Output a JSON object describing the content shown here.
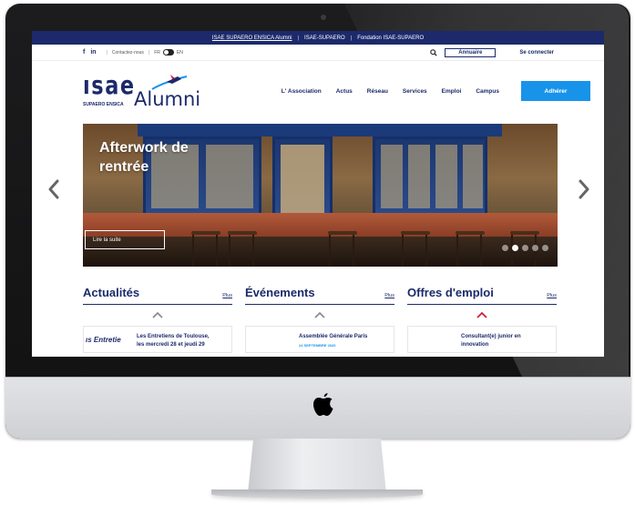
{
  "topbar": {
    "links": [
      "ISAE SUPAERO ENSICA Alumni",
      "ISAE-SUPAERO",
      "Fondation ISAE-SUPAERO"
    ]
  },
  "secondbar": {
    "social": [
      "f",
      "in"
    ],
    "contact": "Contactez-nous",
    "lang_fr": "FR",
    "lang_en": "EN",
    "annuaire": "Annuaire",
    "connect": "Se connecter"
  },
  "logo": {
    "main": "ısae",
    "sub": "SUPAERO  ENSICA",
    "alumni": "Alumni"
  },
  "nav": {
    "items": [
      "L' Association",
      "Actus",
      "Réseau",
      "Services",
      "Emploi",
      "Campus"
    ],
    "cta": "Adhérer"
  },
  "hero": {
    "title_line1": "Afterwork de",
    "title_line2": "rentrée",
    "button": "Lire la suite",
    "slides_total": 5,
    "active_slide": 1
  },
  "sections": [
    {
      "title": "Actualités",
      "more": "Plus",
      "card_thumb": "ıs Entretie",
      "card_title": "Les Entretiens de Toulouse,",
      "card_sub": "les mercredi 28 et jeudi 29"
    },
    {
      "title": "Événements",
      "more": "Plus",
      "card_thumb": "",
      "card_title": "Assemblée Générale Paris",
      "card_sub": "24 SEPTEMBRE 2020"
    },
    {
      "title": "Offres d'emploi",
      "more": "Plus",
      "card_thumb": "",
      "card_title": "Consultant(e) junior en",
      "card_sub": "innovation"
    }
  ],
  "colors": {
    "navy": "#1c2a6b",
    "accent_blue": "#1893ea",
    "emploi_chevron": "#d0203a"
  },
  "icons": [
    "facebook-icon",
    "linkedin-icon",
    "search-icon",
    "chevron-left-icon",
    "chevron-right-icon",
    "chevron-up-icon",
    "apple-logo-icon"
  ]
}
